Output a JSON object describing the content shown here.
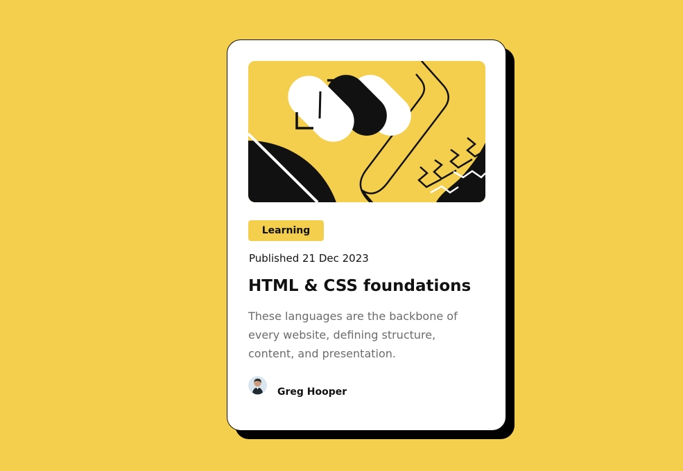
{
  "colors": {
    "page_background": "#f4cf4d",
    "card_background": "#ffffff",
    "accent": "#f4cf4d",
    "text_primary": "#111111",
    "text_secondary": "#6b6b6b",
    "shadow": "#000000"
  },
  "card": {
    "category": "Learning",
    "published": "Published 21 Dec 2023",
    "title": "HTML & CSS foundations",
    "description": "These languages are the backbone of every website, defining structure, content, and presentation.",
    "author": {
      "name": "Greg Hooper"
    }
  },
  "icons": {
    "hero": "abstract-illustration",
    "avatar": "author-photo"
  }
}
